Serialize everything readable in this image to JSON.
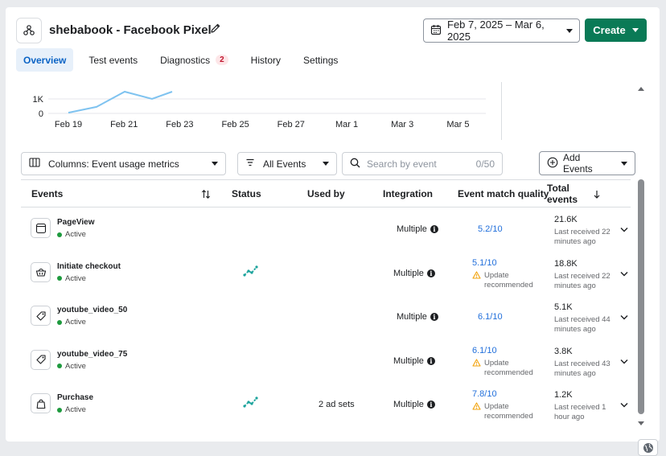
{
  "header": {
    "title": "shebabook - Facebook Pixel",
    "date_range": "Feb 7, 2025 – Mar 6, 2025",
    "create_label": "Create"
  },
  "tabs": [
    {
      "label": "Overview",
      "active": true
    },
    {
      "label": "Test events"
    },
    {
      "label": "Diagnostics",
      "badge": "2"
    },
    {
      "label": "History"
    },
    {
      "label": "Settings"
    }
  ],
  "chart_data": {
    "type": "line",
    "y_ticks": [
      "1K",
      "0"
    ],
    "x_labels": [
      "Feb 19",
      "Feb 21",
      "Feb 23",
      "Feb 25",
      "Feb 27",
      "Mar 1",
      "Mar 3",
      "Mar 5"
    ],
    "series": [
      {
        "values_visible": [
          0.05,
          0.45,
          1.5,
          1.0,
          1.5
        ]
      }
    ],
    "line_color": "#7fc3f0"
  },
  "controls": {
    "columns_label": "Columns: Event usage metrics",
    "events_filter": "All Events",
    "search_placeholder": "Search by event",
    "search_count": "0/50",
    "add_events_label": "Add Events"
  },
  "table": {
    "headers": {
      "events": "Events",
      "status": "Status",
      "used_by": "Used by",
      "integration": "Integration",
      "emq": "Event match quality",
      "total": "Total events"
    },
    "rows": [
      {
        "name": "PageView",
        "status": "Active",
        "used_by": "",
        "integration": "Multiple",
        "emq": "5.2/10",
        "emq_warning": "",
        "total": "21.6K",
        "last": "Last received 22 minutes ago",
        "trend": false
      },
      {
        "name": "Initiate checkout",
        "status": "Active",
        "used_by": "",
        "integration": "Multiple",
        "emq": "5.1/10",
        "emq_warning": "Update recommended",
        "total": "18.8K",
        "last": "Last received 22 minutes ago",
        "trend": true
      },
      {
        "name": "youtube_video_50",
        "status": "Active",
        "used_by": "",
        "integration": "Multiple",
        "emq": "6.1/10",
        "emq_warning": "",
        "total": "5.1K",
        "last": "Last received 44 minutes ago",
        "trend": false
      },
      {
        "name": "youtube_video_75",
        "status": "Active",
        "used_by": "",
        "integration": "Multiple",
        "emq": "6.1/10",
        "emq_warning": "Update recommended",
        "total": "3.8K",
        "last": "Last received 43 minutes ago",
        "trend": false
      },
      {
        "name": "Purchase",
        "status": "Active",
        "used_by": "2 ad sets",
        "integration": "Multiple",
        "emq": "7.8/10",
        "emq_warning": "Update recommended",
        "total": "1.2K",
        "last": "Last received 1 hour ago",
        "trend": true
      }
    ]
  },
  "colors": {
    "primary_green": "#0a7a56",
    "link_blue": "#216fdb",
    "active_dot": "#1e9a3e",
    "trend_teal": "#1ba39c",
    "warning": "#f2a20a"
  }
}
